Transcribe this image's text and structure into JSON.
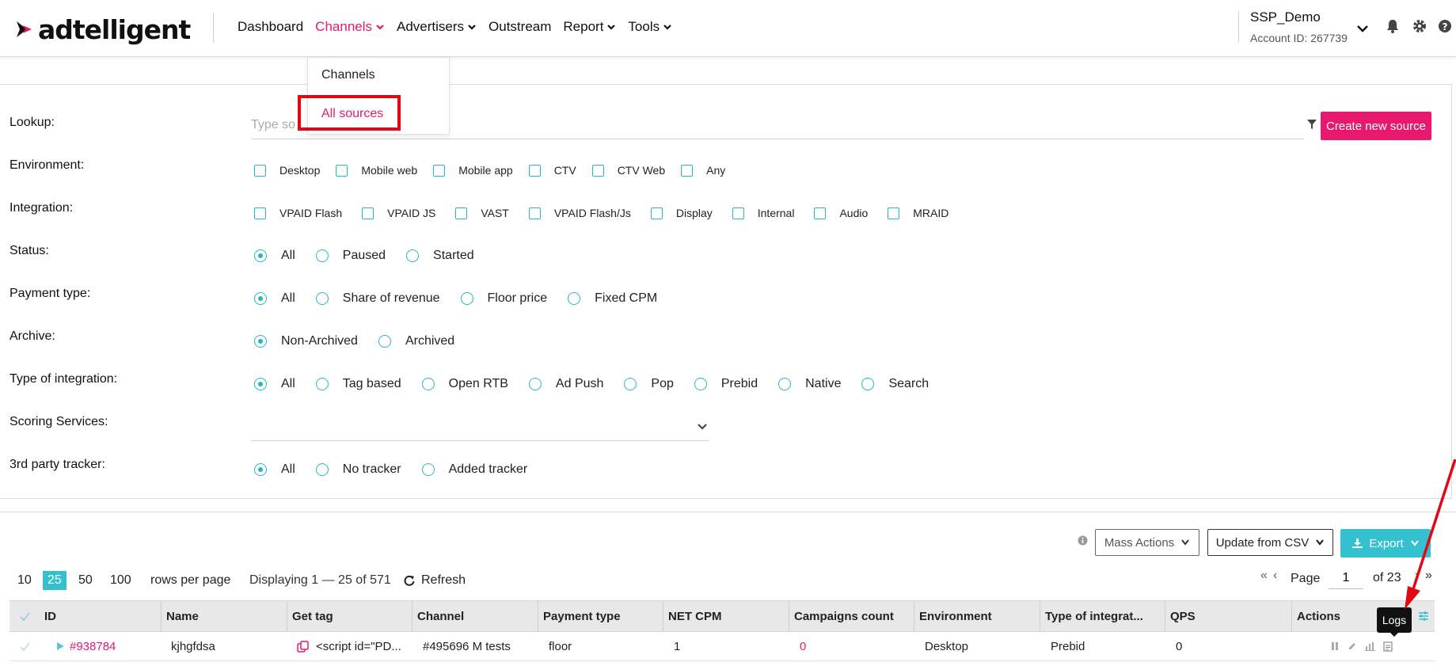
{
  "brand": {
    "logo_text": "adtelligent",
    "accent": "#e8186e",
    "teal": "#27b6c5",
    "annotation": "#e30613"
  },
  "nav": {
    "items": [
      {
        "label": "Dashboard",
        "dropdown": false
      },
      {
        "label": "Channels",
        "dropdown": true,
        "active": true
      },
      {
        "label": "Advertisers",
        "dropdown": true
      },
      {
        "label": "Outstream",
        "dropdown": false
      },
      {
        "label": "Report",
        "dropdown": true
      },
      {
        "label": "Tools",
        "dropdown": true
      }
    ]
  },
  "account": {
    "name": "SSP_Demo",
    "id_label": "Account ID: 267739"
  },
  "header_icons": [
    "bell-icon",
    "gear-icon",
    "help-icon"
  ],
  "dropdown": {
    "items": [
      "Channels",
      "All sources"
    ],
    "selected": "All sources"
  },
  "filters": {
    "lookup": {
      "label": "Lookup:",
      "placeholder": "Type so",
      "create_button": "Create new source"
    },
    "environment": {
      "label": "Environment:",
      "options": [
        "Desktop",
        "Mobile web",
        "Mobile app",
        "CTV",
        "CTV Web",
        "Any"
      ]
    },
    "integration": {
      "label": "Integration:",
      "options": [
        "VPAID Flash",
        "VPAID JS",
        "VAST",
        "VPAID Flash/Js",
        "Display",
        "Internal",
        "Audio",
        "MRAID"
      ]
    },
    "status": {
      "label": "Status:",
      "options": [
        "All",
        "Paused",
        "Started"
      ],
      "selected": "All"
    },
    "payment_type": {
      "label": "Payment type:",
      "options": [
        "All",
        "Share of revenue",
        "Floor price",
        "Fixed CPM"
      ],
      "selected": "All"
    },
    "archive": {
      "label": "Archive:",
      "options": [
        "Non-Archived",
        "Archived"
      ],
      "selected": "Non-Archived"
    },
    "type_of_integration": {
      "label": "Type of integration:",
      "options": [
        "All",
        "Tag based",
        "Open RTB",
        "Ad Push",
        "Pop",
        "Prebid",
        "Native",
        "Search"
      ],
      "selected": "All"
    },
    "scoring": {
      "label": "Scoring Services:"
    },
    "tracker": {
      "label": "3rd party tracker:",
      "options": [
        "All",
        "No tracker",
        "Added tracker"
      ],
      "selected": "All"
    }
  },
  "toolbar": {
    "mass_actions": "Mass Actions",
    "update_csv": "Update from CSV",
    "export": "Export"
  },
  "pagination": {
    "per_page": [
      "10",
      "25",
      "50",
      "100"
    ],
    "per_page_selected": "25",
    "rows_label": "rows per page",
    "displaying": "Displaying 1 — 25 of 571",
    "refresh": "Refresh",
    "page_label": "Page",
    "page_value": "1",
    "of_label": "of 23"
  },
  "table": {
    "columns": [
      "ID",
      "Name",
      "Get tag",
      "Channel",
      "Payment type",
      "NET CPM",
      "Campaigns count",
      "Environment",
      "Type of integrat...",
      "QPS",
      "Actions"
    ],
    "rows": [
      {
        "id": "#938784",
        "name": "kjhgfdsa",
        "tag": "<script id=\"PD...",
        "channel": "#495696 M tests",
        "payment": "floor",
        "net_cpm": "1",
        "campaigns": "0",
        "environment": "Desktop",
        "integration": "Prebid",
        "qps": "0"
      }
    ]
  },
  "tooltip": "Logs"
}
